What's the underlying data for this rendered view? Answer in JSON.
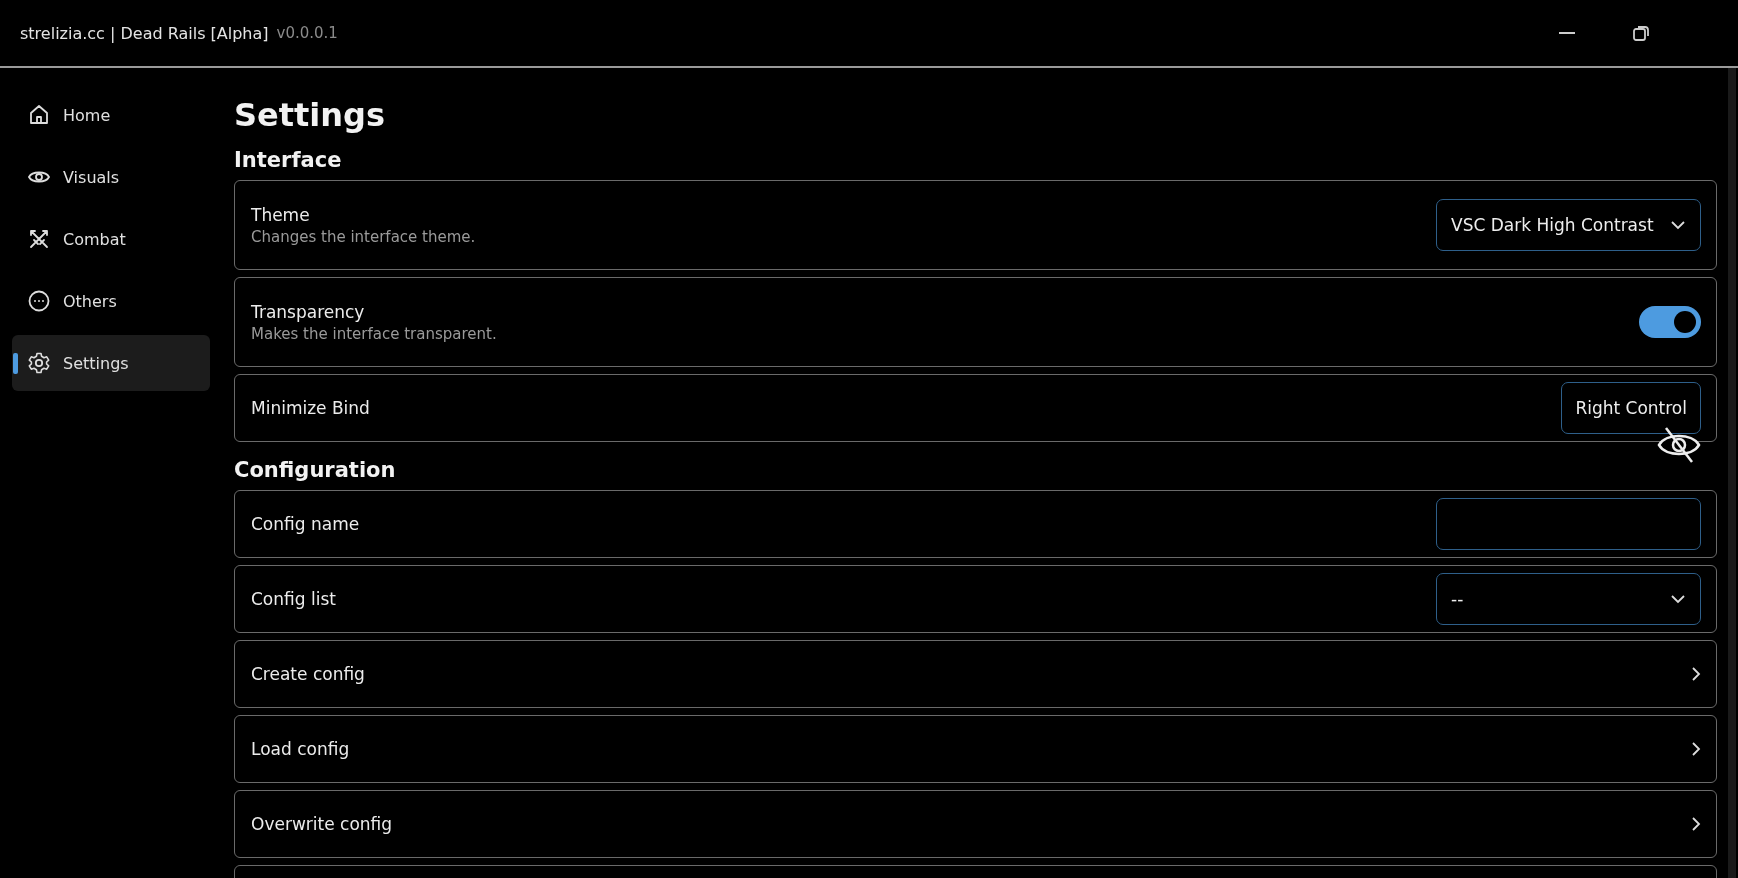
{
  "window": {
    "title": "strelizia.cc | Dead Rails [Alpha]",
    "version": "v0.0.0.1"
  },
  "sidebar": {
    "items": [
      {
        "label": "Home",
        "kind": "home",
        "selected": false
      },
      {
        "label": "Visuals",
        "kind": "eye",
        "selected": false
      },
      {
        "label": "Combat",
        "kind": "swords",
        "selected": false
      },
      {
        "label": "Others",
        "kind": "dots",
        "selected": false
      },
      {
        "label": "Settings",
        "kind": "gear",
        "selected": true
      }
    ]
  },
  "page": {
    "title": "Settings"
  },
  "sections": [
    {
      "title": "Interface",
      "rows": [
        {
          "kind": "dropdown",
          "title": "Theme",
          "description": "Changes the interface theme.",
          "value": "VSC Dark High Contrast"
        },
        {
          "kind": "toggle",
          "title": "Transparency",
          "description": "Makes the interface transparent.",
          "on": true
        },
        {
          "kind": "keybind",
          "title": "Minimize Bind",
          "value": "Right Control"
        }
      ]
    },
    {
      "title": "Configuration",
      "rows": [
        {
          "kind": "input",
          "title": "Config name"
        },
        {
          "kind": "dropdown",
          "title": "Config list",
          "value": "--"
        },
        {
          "kind": "button",
          "title": "Create config"
        },
        {
          "kind": "button",
          "title": "Load config"
        },
        {
          "kind": "button",
          "title": "Overwrite config"
        }
      ]
    }
  ]
}
